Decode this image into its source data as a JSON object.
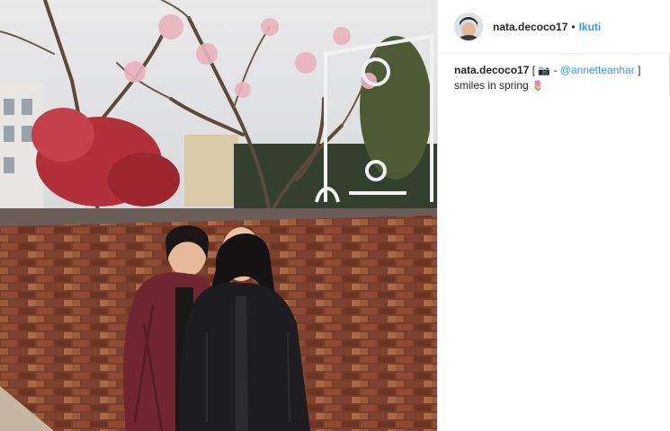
{
  "post": {
    "username": "nata.decoco17",
    "separator": "•",
    "follow_label": "Ikuti",
    "caption": {
      "username": "nata.decoco17",
      "open_bracket": "[",
      "camera_emoji": "📷",
      "dash": "-",
      "mention": "@annetteanhar",
      "close_bracket": "]",
      "text": "smiles in spring",
      "flower_emoji": "🌷"
    }
  },
  "icons": {
    "avatar": "profile-avatar",
    "camera": "camera-emoji",
    "flower": "tulip-emoji"
  }
}
